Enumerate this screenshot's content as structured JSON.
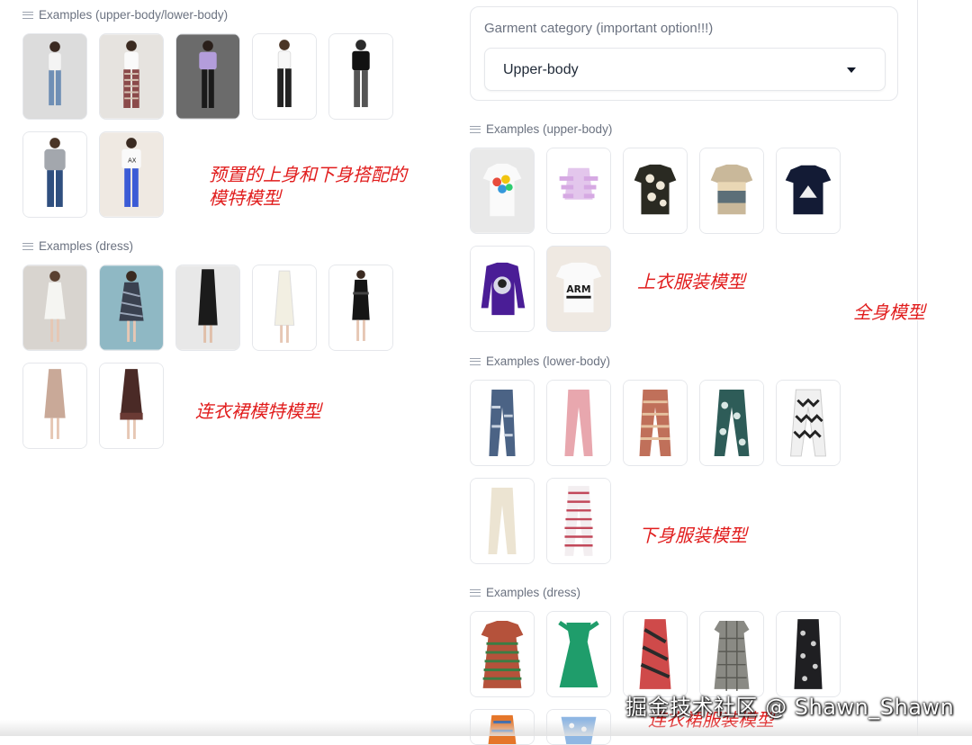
{
  "left": {
    "models_label": "Examples (upper-body/lower-body)",
    "dress_models_label": "Examples (dress)"
  },
  "right": {
    "garment_category": {
      "label": "Garment category (important option!!!)",
      "value": "Upper-body"
    },
    "upper_label": "Examples (upper-body)",
    "lower_label": "Examples (lower-body)",
    "dress_label": "Examples (dress)"
  },
  "annotations": {
    "preset_models_line1": "预置的上身和下身搭配的",
    "preset_models_line2": "模特模型",
    "dress_models": "连衣裙模特模型",
    "upper_garments": "上衣服装模型",
    "full_body": "全身模型",
    "lower_garments": "下身服装模型",
    "dress_garments": "连衣裙服装模型"
  },
  "watermark": "掘金技术社区 @ Shawn_Shawn",
  "colors": {
    "annotation": "#e11d1d",
    "border": "#e5e7eb",
    "label": "#6b7280"
  }
}
